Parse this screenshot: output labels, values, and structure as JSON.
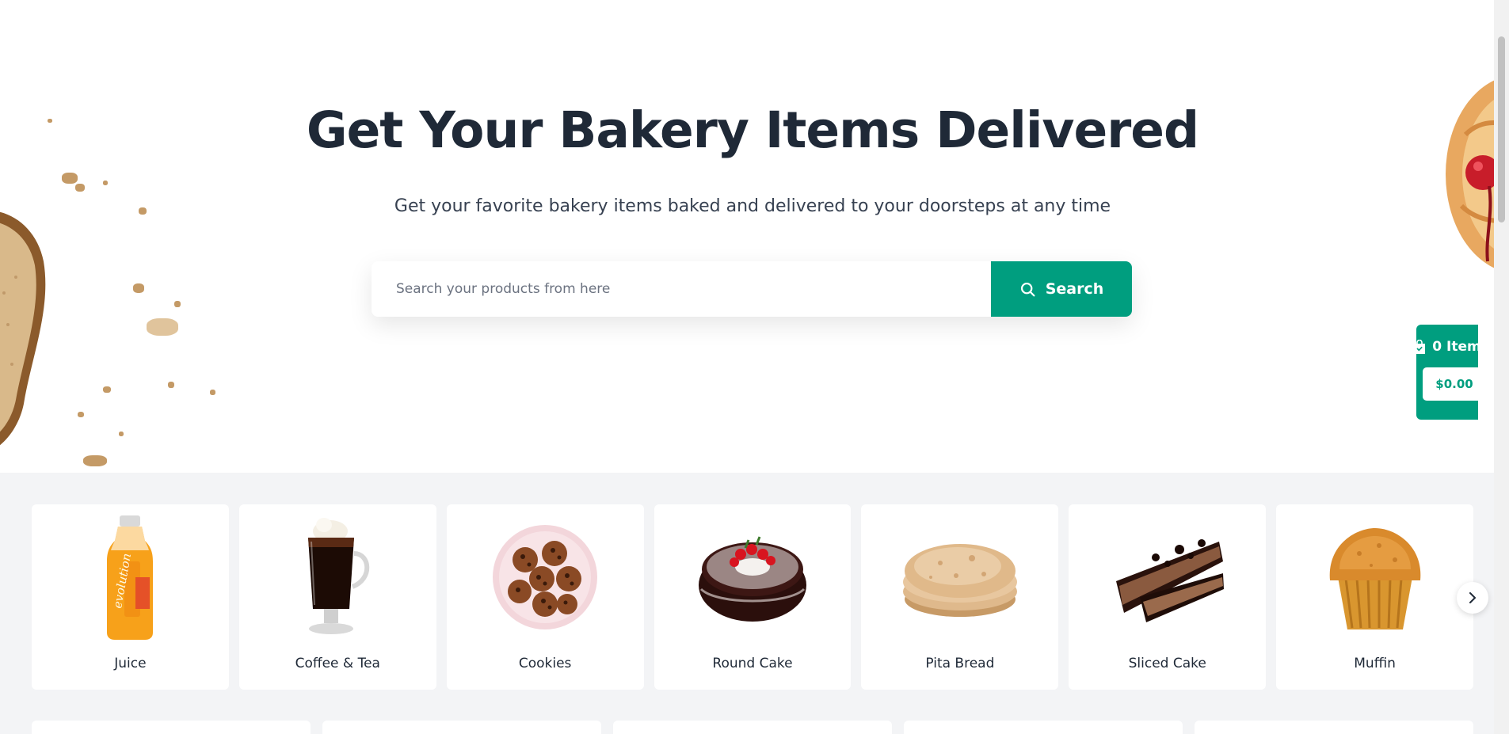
{
  "hero": {
    "title": "Get Your Bakery Items Delivered",
    "subtitle": "Get your favorite bakery items baked and delivered to your doorsteps at any time"
  },
  "search": {
    "placeholder": "Search your products from here",
    "button_label": "Search",
    "icon": "search-icon"
  },
  "cart": {
    "icon": "shopping-bag-icon",
    "count_label": "0 Item",
    "total": "$0.00"
  },
  "categories": [
    {
      "label": "Juice",
      "icon": "juice-bottle-image"
    },
    {
      "label": "Coffee & Tea",
      "icon": "coffee-glass-image"
    },
    {
      "label": "Cookies",
      "icon": "cookies-plate-image"
    },
    {
      "label": "Round Cake",
      "icon": "round-cake-image"
    },
    {
      "label": "Pita Bread",
      "icon": "pita-bread-image"
    },
    {
      "label": "Sliced Cake",
      "icon": "sliced-cake-image"
    },
    {
      "label": "Muffin",
      "icon": "muffin-image"
    }
  ],
  "carousel": {
    "next_icon": "chevron-right-icon"
  },
  "colors": {
    "accent": "#009e7f",
    "title": "#1f2937",
    "page_bg": "#f3f4f6",
    "card_bg": "#ffffff"
  }
}
